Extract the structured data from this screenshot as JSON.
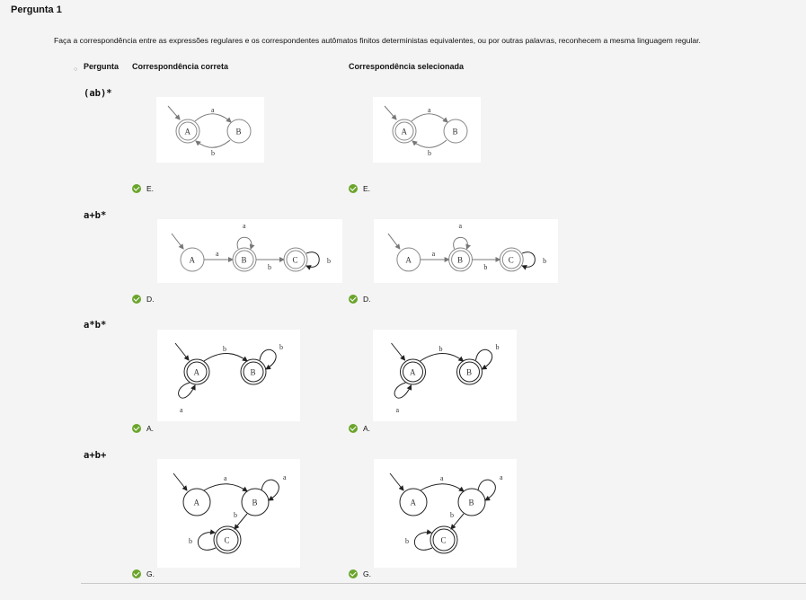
{
  "question_title": "Pergunta 1",
  "prompt": "Faça a correspondência entre as expressões regulares e os correspondentes autômatos finitos deterministas equivalentes, ou por outras palavras, reconhecem a mesma linguagem regular.",
  "headers": {
    "question": "Pergunta",
    "correct": "Correspondência correta",
    "selected": "Correspondência selecionada"
  },
  "rows": [
    {
      "expression": "(ab)*",
      "correct": "E.",
      "selected": "E.",
      "result": "correct"
    },
    {
      "expression": "a+b*",
      "correct": "D.",
      "selected": "D.",
      "result": "correct"
    },
    {
      "expression": "a*b*",
      "correct": "A.",
      "selected": "A.",
      "result": "correct"
    },
    {
      "expression": "a+b+",
      "correct": "G.",
      "selected": "G.",
      "result": "correct"
    }
  ],
  "automata": {
    "ab_star": {
      "states": [
        "A",
        "B"
      ],
      "labels": [
        "a",
        "b"
      ]
    },
    "a_plus_b_star": {
      "states": [
        "A",
        "B",
        "C"
      ],
      "labels": [
        "a",
        "a",
        "b",
        "b"
      ]
    },
    "a_star_b_star": {
      "states": [
        "A",
        "B"
      ],
      "labels": [
        "b",
        "b",
        "a"
      ]
    },
    "a_plus_b_plus": {
      "states": [
        "A",
        "B",
        "C"
      ],
      "labels": [
        "a",
        "a",
        "b",
        "b"
      ]
    }
  },
  "colors": {
    "check": "#6aa52b",
    "background": "#f4f4f4"
  },
  "icons": {
    "result": "check-circle-icon",
    "bullet": "circle-bullet-icon"
  }
}
